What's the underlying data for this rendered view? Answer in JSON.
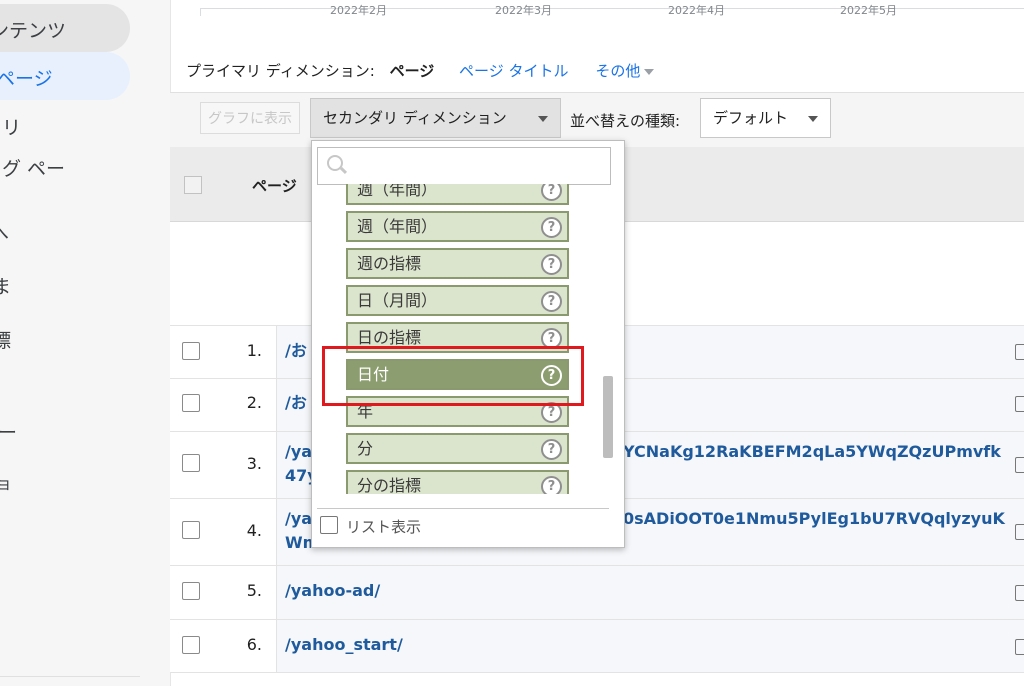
{
  "sidebar": {
    "items": [
      {
        "label": "ンテンツ"
      },
      {
        "label": "ページ"
      },
      {
        "label": "リ"
      },
      {
        "label": "グ ペー"
      },
      {
        "label": "へ"
      },
      {
        "label": "ま"
      },
      {
        "label": "標"
      },
      {
        "label": "ー"
      },
      {
        "label": "ョ"
      }
    ]
  },
  "chart": {
    "labels": [
      "2022年2月",
      "2022年3月",
      "2022年4月",
      "2022年5月"
    ]
  },
  "primary_dimension": {
    "label": "プライマリ ディメンション:",
    "current": "ページ",
    "options": [
      "ページ タイトル",
      "その他"
    ]
  },
  "toolbar": {
    "graph_button": "グラフに表示",
    "secondary_dimension": "セカンダリ ディメンション",
    "sort_label": "並べ替えの種類:",
    "sort_value": "デフォルト"
  },
  "table": {
    "page_header": "ページ",
    "rows": [
      {
        "num": "1.",
        "page": "/お"
      },
      {
        "num": "2.",
        "page": "/お"
      },
      {
        "num": "3.",
        "page": "/ya",
        "page_line2": "47y",
        "page_extra": "YCNaKg12RaKBEFM2qLa5YWqZQzUPmvfk"
      },
      {
        "num": "4.",
        "page": "/ya",
        "page_line2": "Wmb3Sc0Kbumo",
        "page_extra": "0sADiOOT0e1Nmu5PylEg1bU7RVQqlyzyuK"
      },
      {
        "num": "5.",
        "page": "/yahoo-ad/"
      },
      {
        "num": "6.",
        "page": "/yahoo_start/"
      }
    ]
  },
  "dropdown": {
    "search_value": "",
    "items": [
      "週（年間）",
      "週（年間）",
      "週の指標",
      "日（月間）",
      "日の指標",
      "日付",
      "年",
      "分",
      "分の指標"
    ],
    "selected": "日付",
    "help_glyph": "?",
    "list_view_label": "リスト表示"
  },
  "colors": {
    "link": "#1a73e8",
    "dimension_item_bg": "#dbe4cd",
    "dimension_selected_bg": "#8c9d6f",
    "highlight": "#e0191f"
  }
}
